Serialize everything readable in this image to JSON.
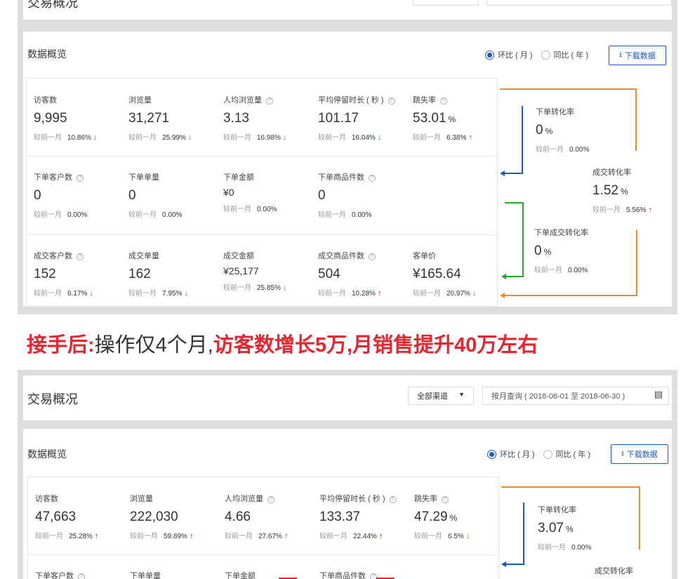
{
  "top": {
    "header": {
      "title": "交易概况"
    },
    "overview": {
      "title": "数据概览",
      "mom_label": "环比 ( 月 )",
      "yoy_label": "同比 ( 年 )",
      "download_label": "下载数据",
      "compare_prefix": "较前一月",
      "rows": [
        [
          {
            "label": "访客数",
            "help": false,
            "value": "9,995",
            "unit": "",
            "pct": "10.86%",
            "trend": "down"
          },
          {
            "label": "浏览量",
            "help": false,
            "value": "31,271",
            "unit": "",
            "pct": "25.99%",
            "trend": "down"
          },
          {
            "label": "人均浏览量",
            "help": true,
            "value": "3.13",
            "unit": "",
            "pct": "16.98%",
            "trend": "down"
          },
          {
            "label": "平均停留时长 ( 秒 )",
            "help": true,
            "value": "101.17",
            "unit": "",
            "pct": "16.04%",
            "trend": "down"
          },
          {
            "label": "跳失率",
            "help": true,
            "value": "53.01",
            "unit": "%",
            "pct": "6.38%",
            "trend": "up"
          }
        ],
        [
          {
            "label": "下单客户数",
            "help": true,
            "value": "0",
            "unit": "",
            "pct": "0.00%",
            "trend": ""
          },
          {
            "label": "下单单量",
            "help": false,
            "value": "0",
            "unit": "",
            "pct": "0.00%",
            "trend": ""
          },
          {
            "label": "下单金额",
            "help": false,
            "value": "¥0",
            "unit": "",
            "pct": "0.00%",
            "trend": "",
            "small": true
          },
          {
            "label": "下单商品件数",
            "help": true,
            "value": "0",
            "unit": "",
            "pct": "0.00%",
            "trend": ""
          }
        ],
        [
          {
            "label": "成交客户数",
            "help": true,
            "value": "152",
            "unit": "",
            "pct": "6.17%",
            "trend": "down"
          },
          {
            "label": "成交单量",
            "help": false,
            "value": "162",
            "unit": "",
            "pct": "7.95%",
            "trend": "down"
          },
          {
            "label": "成交金额",
            "help": false,
            "value": "¥25,177",
            "unit": "",
            "pct": "25.85%",
            "trend": "down",
            "small": true
          },
          {
            "label": "成交商品件数",
            "help": true,
            "value": "504",
            "unit": "",
            "pct": "10.28%",
            "trend": "up"
          },
          {
            "label": "客单价",
            "help": false,
            "value": "¥165.64",
            "unit": "",
            "pct": "20.97%",
            "trend": "down"
          }
        ]
      ],
      "funnel": [
        {
          "label": "下单转化率",
          "value": "0",
          "unit": "%",
          "pct": "0.00%",
          "trend": ""
        },
        {
          "label": "成交转化率",
          "value": "1.52",
          "unit": "%",
          "pct": "5.56%",
          "trend": "up"
        },
        {
          "label": "下单成交转化率",
          "value": "0",
          "unit": "%",
          "pct": "0.00%",
          "trend": ""
        }
      ]
    }
  },
  "banner": {
    "part1": "接手后:",
    "part2": "操作仅4个月,",
    "part3": "访客数增长5万,月销售提升40万左右"
  },
  "bottom": {
    "header": {
      "title": "交易概况",
      "channel_select": "全部渠道",
      "date_range": "按月查询 ( 2018-06-01 至 2018-06-30 )"
    },
    "overview": {
      "title": "数据概览",
      "mom_label": "环比 ( 月 )",
      "yoy_label": "同比 ( 年 )",
      "download_label": "下载数据",
      "compare_prefix": "较前一月",
      "rows": [
        [
          {
            "label": "访客数",
            "help": false,
            "value": "47,663",
            "unit": "",
            "pct": "25.28%",
            "trend": "up"
          },
          {
            "label": "浏览量",
            "help": false,
            "value": "222,030",
            "unit": "",
            "pct": "59.89%",
            "trend": "up"
          },
          {
            "label": "人均浏览量",
            "help": true,
            "value": "4.66",
            "unit": "",
            "pct": "27.67%",
            "trend": "up"
          },
          {
            "label": "平均停留时长 ( 秒 )",
            "help": true,
            "value": "133.37",
            "unit": "",
            "pct": "22.44%",
            "trend": "up"
          },
          {
            "label": "跳失率",
            "help": true,
            "value": "47.29",
            "unit": "%",
            "pct": "6.5%",
            "trend": "down"
          }
        ],
        [
          {
            "label": "下单客户数",
            "help": true
          },
          {
            "label": "下单单量",
            "help": false
          },
          {
            "label": "下单金额",
            "help": false
          },
          {
            "label": "下单商品件数",
            "help": true
          }
        ]
      ],
      "funnel": [
        {
          "label": "下单转化率",
          "value": "3.07",
          "unit": "%",
          "pct": "0.00%",
          "trend": ""
        },
        {
          "label": "成交转化率"
        }
      ]
    }
  },
  "colors": {
    "accent_blue": "#1a58c6",
    "up_red": "#e0191f",
    "down_green": "#2aa52a",
    "funnel_orange": "#f08a24",
    "funnel_blue": "#1a58c6",
    "funnel_green": "#2aa52a"
  }
}
